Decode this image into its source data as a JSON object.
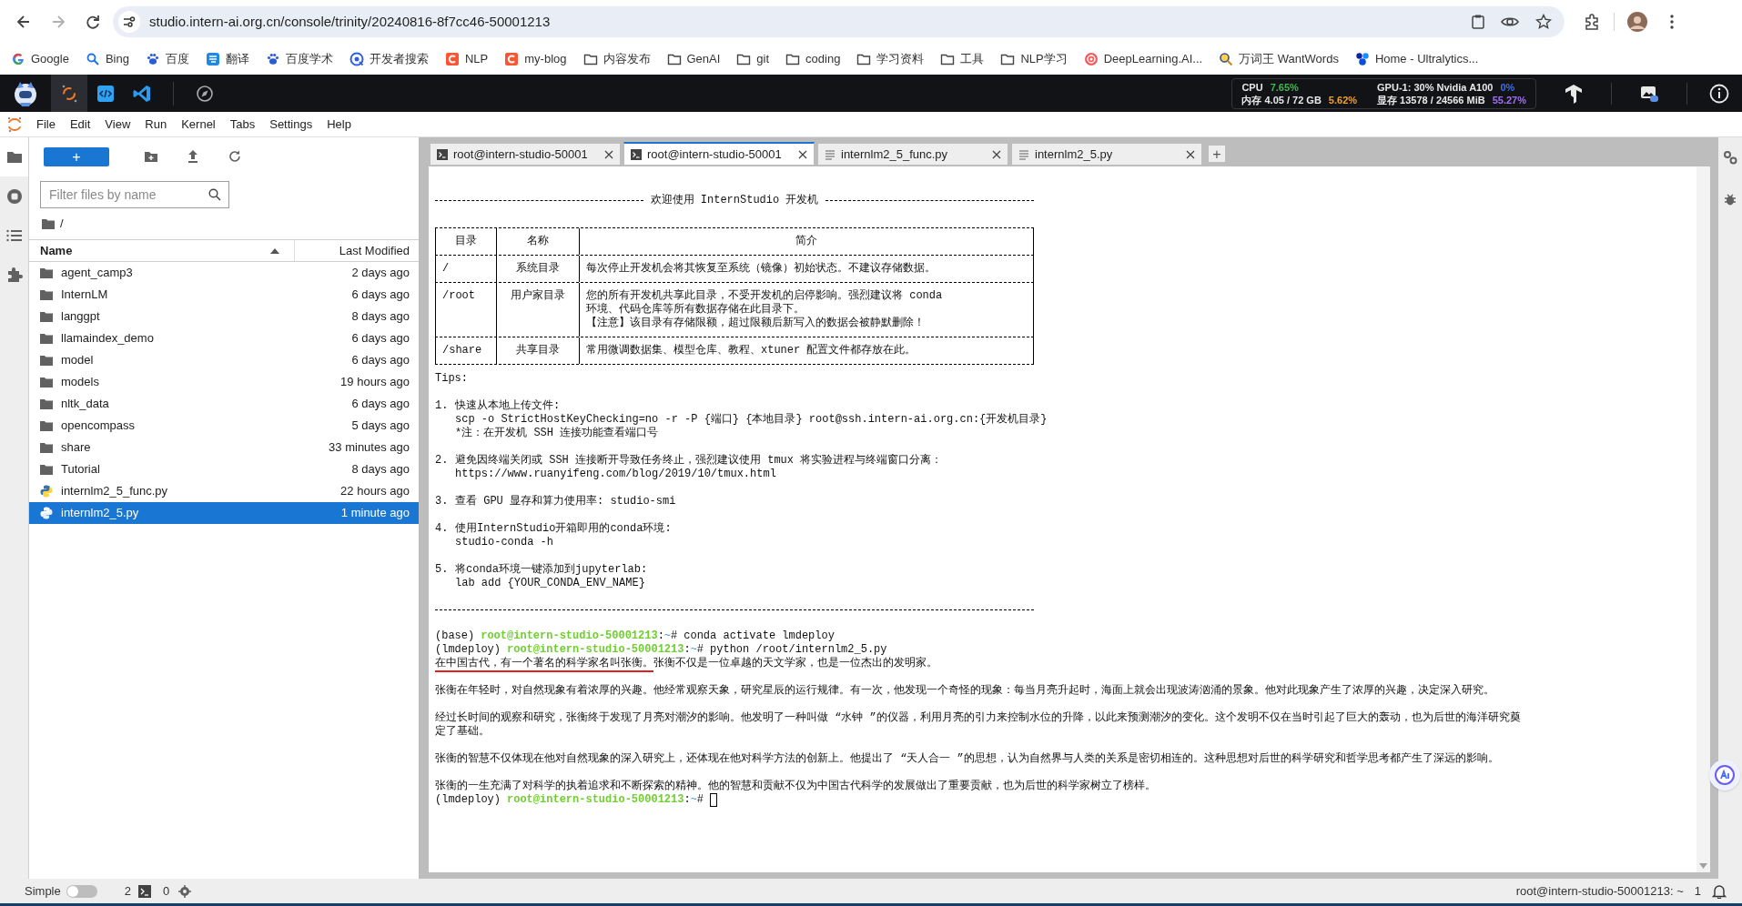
{
  "browser": {
    "url": "studio.intern-ai.org.cn/console/trinity/20240816-8f7cc46-50001213",
    "forward_disabled": true
  },
  "bookmarks": [
    {
      "kind": "link",
      "label": "Google"
    },
    {
      "kind": "link",
      "label": "Bing"
    },
    {
      "kind": "link",
      "label": "百度"
    },
    {
      "kind": "link",
      "label": "翻译"
    },
    {
      "kind": "link",
      "label": "百度学术"
    },
    {
      "kind": "link",
      "label": "开发者搜索"
    },
    {
      "kind": "link",
      "label": "NLP"
    },
    {
      "kind": "link",
      "label": "my-blog"
    },
    {
      "kind": "folder",
      "label": "内容发布"
    },
    {
      "kind": "folder",
      "label": "GenAI"
    },
    {
      "kind": "folder",
      "label": "git"
    },
    {
      "kind": "folder",
      "label": "coding"
    },
    {
      "kind": "folder",
      "label": "学习资料"
    },
    {
      "kind": "folder",
      "label": "工具"
    },
    {
      "kind": "folder",
      "label": "NLP学习"
    },
    {
      "kind": "link",
      "label": "DeepLearning.AI..."
    },
    {
      "kind": "link",
      "label": "万词王 WantWords"
    },
    {
      "kind": "link",
      "label": "Home - Ultralytics..."
    }
  ],
  "topbar": {
    "apps": [
      {
        "selected": true
      },
      {
        "selected": false
      },
      {
        "selected": false
      },
      {
        "selected": false
      }
    ],
    "stats": [
      {
        "label": "CPU",
        "value": "7.65%",
        "color": "#3fb950"
      },
      {
        "label": "GPU-1: 30% Nvidia A100",
        "value": "0%",
        "color": "#3b6cf6"
      },
      {
        "label": "内存 4.05 / 72 GB",
        "value": "5.62%",
        "color": "#f0a030"
      },
      {
        "label": "显存 13578 / 24566 MiB",
        "value": "55.27%",
        "color": "#a070f0"
      }
    ]
  },
  "menu": [
    "File",
    "Edit",
    "View",
    "Run",
    "Kernel",
    "Tabs",
    "Settings",
    "Help"
  ],
  "sidebar_tabs": [
    {
      "selected": true
    },
    {
      "selected": false
    },
    {
      "selected": false
    },
    {
      "selected": false
    }
  ],
  "file_browser": {
    "new_button": "+",
    "filter_placeholder": "Filter files by name",
    "path": "/",
    "columns": [
      "Name",
      "Last Modified"
    ],
    "rows": [
      {
        "kind": "folder",
        "name": "agent_camp3",
        "modified": "2 days ago",
        "selected": false
      },
      {
        "kind": "folder",
        "name": "InternLM",
        "modified": "6 days ago",
        "selected": false
      },
      {
        "kind": "folder",
        "name": "langgpt",
        "modified": "8 days ago",
        "selected": false
      },
      {
        "kind": "folder",
        "name": "llamaindex_demo",
        "modified": "6 days ago",
        "selected": false
      },
      {
        "kind": "folder",
        "name": "model",
        "modified": "6 days ago",
        "selected": false
      },
      {
        "kind": "folder",
        "name": "models",
        "modified": "19 hours ago",
        "selected": false
      },
      {
        "kind": "folder",
        "name": "nltk_data",
        "modified": "6 days ago",
        "selected": false
      },
      {
        "kind": "folder",
        "name": "opencompass",
        "modified": "5 days ago",
        "selected": false
      },
      {
        "kind": "folder",
        "name": "share",
        "modified": "33 minutes ago",
        "selected": false
      },
      {
        "kind": "folder",
        "name": "Tutorial",
        "modified": "8 days ago",
        "selected": false
      },
      {
        "kind": "python",
        "name": "internlm2_5_func.py",
        "modified": "22 hours ago",
        "selected": false
      },
      {
        "kind": "python",
        "name": "internlm2_5.py",
        "modified": "1 minute ago",
        "selected": true
      }
    ]
  },
  "tabs": [
    {
      "kind": "terminal",
      "label": "root@intern-studio-50001",
      "selected": false
    },
    {
      "kind": "terminal",
      "label": "root@intern-studio-50001",
      "selected": true
    },
    {
      "kind": "file",
      "label": "internlm2_5_func.py",
      "selected": false
    },
    {
      "kind": "file",
      "label": "internlm2_5.py",
      "selected": false
    }
  ],
  "new_tab": "+",
  "terminal": {
    "banner": "欢迎使用 InternStudio 开发机",
    "table": {
      "columns": [
        "目录",
        "名称",
        "简介"
      ],
      "rows": [
        {
          "directory": "/",
          "name": "系统目录",
          "description": [
            "每次停止开发机会将其恢复至系统（镜像）初始状态。不建议存储数据。"
          ]
        },
        {
          "directory": "/root",
          "name": "用户家目录",
          "description": [
            "您的所有开发机共享此目录，不受开发机的启停影响。强烈建议将 conda",
            "环境、代码仓库等所有数据存储在此目录下。",
            "【注意】该目录有存储限额，超过限额后新写入的数据会被静默删除！"
          ]
        },
        {
          "directory": "/share",
          "name": "共享目录",
          "description": [
            "常用微调数据集、模型仓库、教程、xtuner 配置文件都存放在此。"
          ]
        }
      ]
    },
    "tips_label": "Tips:",
    "tips": [
      {
        "number": "1.",
        "lines": [
          "快速从本地上传文件:",
          "scp -o StrictHostKeyChecking=no -r -P {端口} {本地目录} root@ssh.intern-ai.org.cn:{开发机目录}",
          "*注：在开发机 SSH 连接功能查看端口号"
        ]
      },
      {
        "number": "2.",
        "lines": [
          "避免因终端关闭或 SSH 连接断开导致任务终止，强烈建议使用 tmux 将实验进程与终端窗口分离：",
          "https://www.ruanyifeng.com/blog/2019/10/tmux.html"
        ]
      },
      {
        "number": "3.",
        "lines": [
          "查看 GPU 显存和算力使用率: studio-smi"
        ]
      },
      {
        "number": "4.",
        "lines": [
          "使用InternStudio开箱即用的conda环境:",
          "studio-conda -h"
        ]
      },
      {
        "number": "5.",
        "lines": [
          "将conda环境一键添加到jupyterlab:",
          "lab add {YOUR_CONDA_ENV_NAME}"
        ]
      }
    ],
    "session": [
      {
        "kind": "prompt",
        "env": "(base)",
        "host": "root@intern-studio-50001213",
        "sep": ":",
        "path": "~",
        "symbol": "#",
        "command": "conda activate lmdeploy",
        "cursor": false
      },
      {
        "kind": "prompt",
        "env": "(lmdeploy)",
        "host": "root@intern-studio-50001213",
        "sep": ":",
        "path": "~",
        "symbol": "#",
        "command": "python /root/internlm2_5.py",
        "cursor": false
      },
      {
        "kind": "output",
        "underlined": "在中国古代，有一个著名的科学家名叫张衡。",
        "lines": [
          "张衡不仅是一位卓越的天文学家，也是一位杰出的发明家。"
        ]
      },
      {
        "kind": "blank"
      },
      {
        "kind": "output",
        "lines": [
          "张衡在年轻时，对自然现象有着浓厚的兴趣。他经常观察天象，研究星辰的运行规律。有一次，他发现一个奇怪的现象：每当月亮升起时，海面上就会出现波涛汹涌的景象。他对此现象产生了浓厚的兴趣，决定深入研究。"
        ]
      },
      {
        "kind": "blank"
      },
      {
        "kind": "output",
        "lines": [
          "经过长时间的观察和研究，张衡终于发现了月亮对潮汐的影响。他发明了一种叫做 “水钟 ”的仪器，利用月亮的引力来控制水位的升降，以此来预测潮汐的变化。这个发明不仅在当时引起了巨大的轰动，也为后世的海洋研究奠",
          "定了基础。"
        ]
      },
      {
        "kind": "blank"
      },
      {
        "kind": "output",
        "lines": [
          "张衡的智慧不仅体现在他对自然现象的深入研究上，还体现在他对科学方法的创新上。他提出了 “天人合一 ”的思想，认为自然界与人类的关系是密切相连的。这种思想对后世的科学研究和哲学思考都产生了深远的影响。"
        ]
      },
      {
        "kind": "blank"
      },
      {
        "kind": "output",
        "lines": [
          "张衡的一生充满了对科学的执着追求和不断探索的精神。他的智慧和贡献不仅为中国古代科学的发展做出了重要贡献，也为后世的科学家树立了榜样。"
        ]
      },
      {
        "kind": "prompt",
        "env": "(lmdeploy)",
        "host": "root@intern-studio-50001213",
        "sep": ":",
        "path": "~",
        "symbol": "#",
        "cursor": true
      }
    ]
  },
  "status_bar": {
    "mode_label": "Simple",
    "simple_mode": false,
    "terminals": "2",
    "kernels": "0",
    "location": "root@intern-studio-50001213: ~",
    "notifications": "1"
  }
}
